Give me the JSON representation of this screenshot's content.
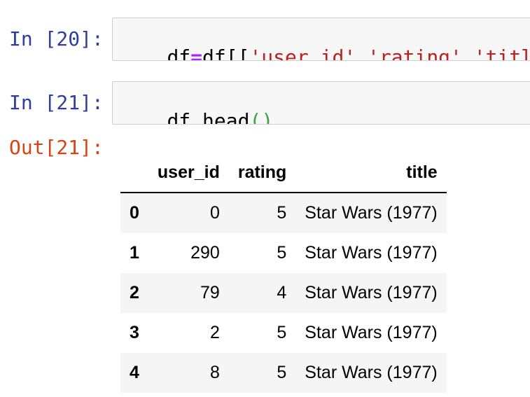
{
  "cells": [
    {
      "prompt": "In [20]:",
      "tokens": [
        {
          "text": "df",
          "kind": "plain"
        },
        {
          "text": "=",
          "kind": "op"
        },
        {
          "text": "df[[",
          "kind": "plain"
        },
        {
          "text": "'user_id'",
          "kind": "str"
        },
        {
          "text": ",",
          "kind": "plain"
        },
        {
          "text": "'rating'",
          "kind": "str"
        },
        {
          "text": ",",
          "kind": "plain"
        },
        {
          "text": "'title'",
          "kind": "str"
        },
        {
          "text": "]]",
          "kind": "plain"
        }
      ]
    },
    {
      "prompt": "In [21]:",
      "tokens": [
        {
          "text": "df.head",
          "kind": "plain"
        },
        {
          "text": "(",
          "kind": "paren"
        },
        {
          "text": ")",
          "kind": "paren"
        }
      ]
    }
  ],
  "output": {
    "prompt": "Out[21]:",
    "table": {
      "columns": [
        "",
        "user_id",
        "rating",
        "title"
      ],
      "rows": [
        {
          "index": "0",
          "user_id": "0",
          "rating": "5",
          "title": "Star Wars (1977)"
        },
        {
          "index": "1",
          "user_id": "290",
          "rating": "5",
          "title": "Star Wars (1977)"
        },
        {
          "index": "2",
          "user_id": "79",
          "rating": "4",
          "title": "Star Wars (1977)"
        },
        {
          "index": "3",
          "user_id": "2",
          "rating": "5",
          "title": "Star Wars (1977)"
        },
        {
          "index": "4",
          "user_id": "8",
          "rating": "5",
          "title": "Star Wars (1977)"
        }
      ]
    }
  },
  "colors": {
    "in_prompt": "#303f9f",
    "out_prompt": "#d84315",
    "string": "#ba2121",
    "operator": "#aa22ff",
    "paren": "#3aa63a",
    "cell_background": "#f7f7f7",
    "striped_row": "#f5f5f5"
  }
}
